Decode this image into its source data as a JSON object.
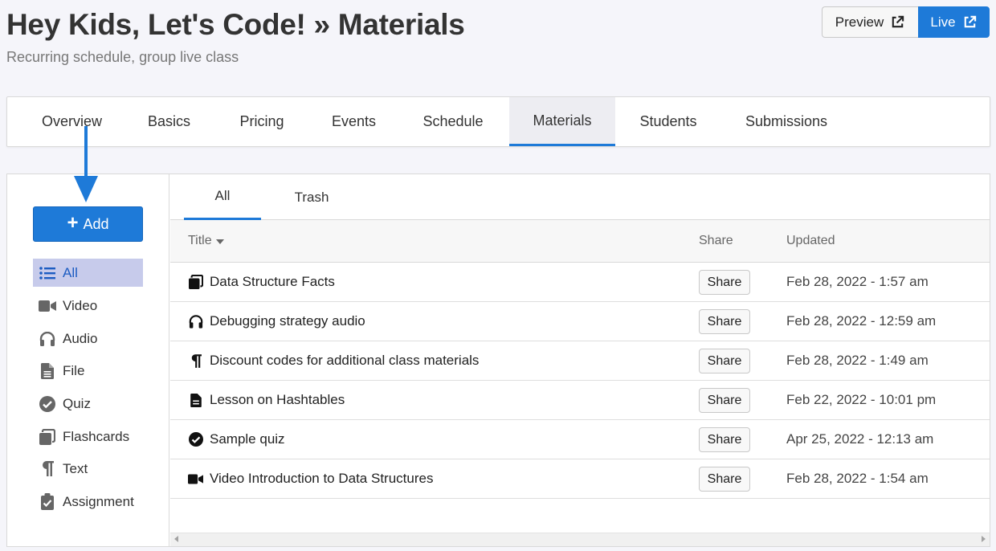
{
  "header": {
    "title": "Hey Kids, Let's Code! » Materials",
    "subtitle": "Recurring schedule, group live class",
    "preview_label": "Preview",
    "live_label": "Live"
  },
  "tabs": [
    {
      "label": "Overview"
    },
    {
      "label": "Basics"
    },
    {
      "label": "Pricing"
    },
    {
      "label": "Events"
    },
    {
      "label": "Schedule"
    },
    {
      "label": "Materials",
      "active": true
    },
    {
      "label": "Students"
    },
    {
      "label": "Submissions"
    }
  ],
  "sidebar": {
    "add_label": "Add",
    "items": [
      {
        "label": "All",
        "icon": "list-icon",
        "active": true
      },
      {
        "label": "Video",
        "icon": "video-icon"
      },
      {
        "label": "Audio",
        "icon": "headphones-icon"
      },
      {
        "label": "File",
        "icon": "file-icon"
      },
      {
        "label": "Quiz",
        "icon": "check-circle-icon"
      },
      {
        "label": "Flashcards",
        "icon": "flashcards-icon"
      },
      {
        "label": "Text",
        "icon": "paragraph-icon"
      },
      {
        "label": "Assignment",
        "icon": "clipboard-check-icon"
      }
    ]
  },
  "subtabs": [
    {
      "label": "All",
      "active": true
    },
    {
      "label": "Trash"
    }
  ],
  "table": {
    "columns": {
      "title": "Title",
      "share": "Share",
      "updated": "Updated"
    },
    "rows": [
      {
        "icon": "flashcards-icon",
        "title": "Data Structure Facts",
        "share": "Share",
        "updated": "Feb 28, 2022 - 1:57 am"
      },
      {
        "icon": "headphones-icon",
        "title": "Debugging strategy audio",
        "share": "Share",
        "updated": "Feb 28, 2022 - 12:59 am"
      },
      {
        "icon": "paragraph-icon",
        "title": "Discount codes for additional class materials",
        "share": "Share",
        "updated": "Feb 28, 2022 - 1:49 am"
      },
      {
        "icon": "file-icon",
        "title": "Lesson on Hashtables",
        "share": "Share",
        "updated": "Feb 22, 2022 - 10:01 pm"
      },
      {
        "icon": "check-circle-icon",
        "title": "Sample quiz",
        "share": "Share",
        "updated": "Apr 25, 2022 - 12:13 am"
      },
      {
        "icon": "video-icon",
        "title": "Video Introduction to Data Structures",
        "share": "Share",
        "updated": "Feb 28, 2022 - 1:54 am"
      }
    ]
  },
  "colors": {
    "accent": "#1e7ad8",
    "active_side_bg": "#c7cbeb",
    "page_bg": "#f5f5fa"
  }
}
